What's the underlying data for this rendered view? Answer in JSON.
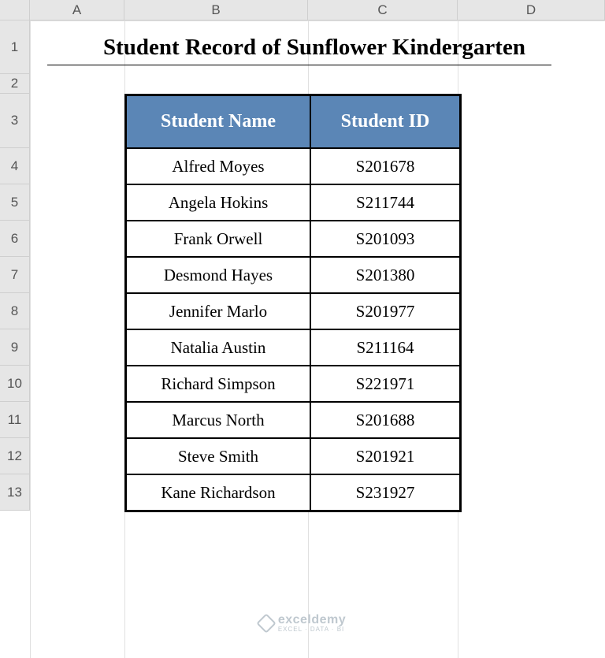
{
  "columns": {
    "A": "A",
    "B": "B",
    "C": "C",
    "D": "D"
  },
  "rows": [
    "1",
    "2",
    "3",
    "4",
    "5",
    "6",
    "7",
    "8",
    "9",
    "10",
    "11",
    "12",
    "13"
  ],
  "title": "Student Record of Sunflower Kindergarten",
  "table": {
    "headers": {
      "name": "Student Name",
      "id": "Student ID"
    },
    "rows": [
      {
        "name": "Alfred Moyes",
        "id": "S201678"
      },
      {
        "name": "Angela Hokins",
        "id": "S211744"
      },
      {
        "name": "Frank Orwell",
        "id": "S201093"
      },
      {
        "name": "Desmond Hayes",
        "id": "S201380"
      },
      {
        "name": "Jennifer Marlo",
        "id": "S201977"
      },
      {
        "name": "Natalia Austin",
        "id": "S211164"
      },
      {
        "name": "Richard Simpson",
        "id": "S221971"
      },
      {
        "name": "Marcus North",
        "id": "S201688"
      },
      {
        "name": "Steve Smith",
        "id": "S201921"
      },
      {
        "name": "Kane Richardson",
        "id": "S231927"
      }
    ]
  },
  "watermark": {
    "brand": "exceldemy",
    "tagline": "EXCEL · DATA · BI"
  },
  "layout": {
    "colX": {
      "A": 38,
      "B": 158,
      "C": 391,
      "D": 581,
      "E": 768
    },
    "rowY": [
      26,
      94,
      119,
      188,
      234,
      280,
      326,
      372,
      418,
      464,
      510,
      556,
      602,
      648
    ]
  }
}
